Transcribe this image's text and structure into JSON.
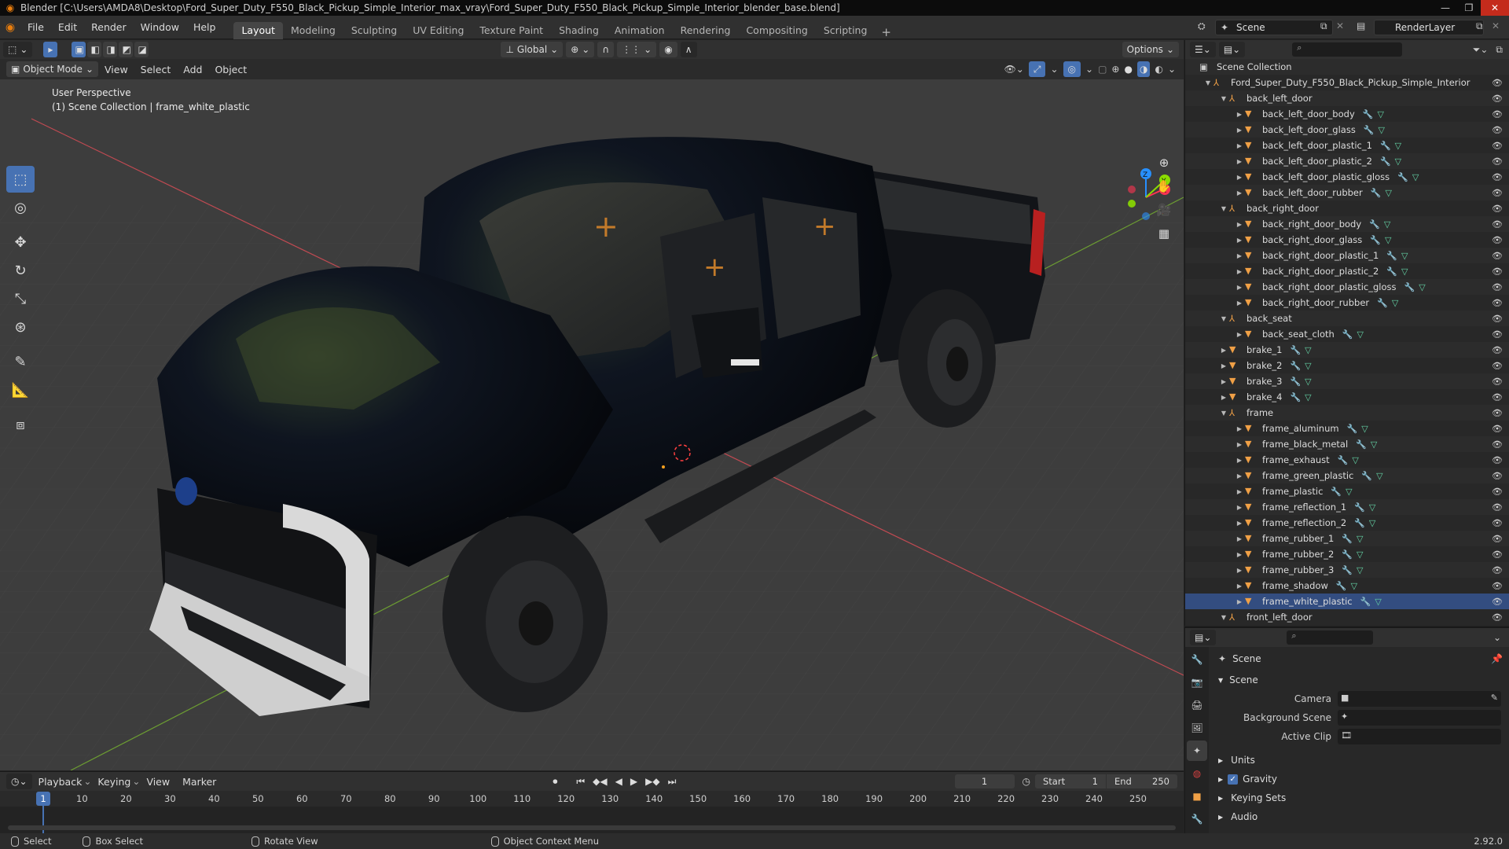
{
  "window": {
    "title": "Blender [C:\\Users\\AMDA8\\Desktop\\Ford_Super_Duty_F550_Black_Pickup_Simple_Interior_max_vray\\Ford_Super_Duty_F550_Black_Pickup_Simple_Interior_blender_base.blend]"
  },
  "menu": [
    "File",
    "Edit",
    "Render",
    "Window",
    "Help"
  ],
  "workspaces": [
    "Layout",
    "Modeling",
    "Sculpting",
    "UV Editing",
    "Texture Paint",
    "Shading",
    "Animation",
    "Rendering",
    "Compositing",
    "Scripting"
  ],
  "active_workspace": "Layout",
  "scene_name": "Scene",
  "render_layer": "RenderLayer",
  "viewport": {
    "mode": "Object Mode",
    "menus": [
      "View",
      "Select",
      "Add",
      "Object"
    ],
    "transform_orientation": "Global",
    "options_label": "Options",
    "overlay_line1": "User Perspective",
    "overlay_line2": "(1) Scene Collection | frame_white_plastic"
  },
  "gizmo": {
    "x": "X",
    "y": "Y",
    "z": "Z"
  },
  "outliner": {
    "root": "Scene Collection",
    "rows": [
      {
        "label": "Ford_Super_Duty_F550_Black_Pickup_Simple_Interior",
        "level": 0,
        "kind": "empty",
        "expanded": true
      },
      {
        "label": "back_left_door",
        "level": 1,
        "kind": "empty",
        "expanded": true
      },
      {
        "label": "back_left_door_body",
        "level": 2,
        "kind": "mesh"
      },
      {
        "label": "back_left_door_glass",
        "level": 2,
        "kind": "mesh"
      },
      {
        "label": "back_left_door_plastic_1",
        "level": 2,
        "kind": "mesh"
      },
      {
        "label": "back_left_door_plastic_2",
        "level": 2,
        "kind": "mesh"
      },
      {
        "label": "back_left_door_plastic_gloss",
        "level": 2,
        "kind": "mesh"
      },
      {
        "label": "back_left_door_rubber",
        "level": 2,
        "kind": "mesh"
      },
      {
        "label": "back_right_door",
        "level": 1,
        "kind": "empty",
        "expanded": true
      },
      {
        "label": "back_right_door_body",
        "level": 2,
        "kind": "mesh"
      },
      {
        "label": "back_right_door_glass",
        "level": 2,
        "kind": "mesh"
      },
      {
        "label": "back_right_door_plastic_1",
        "level": 2,
        "kind": "mesh"
      },
      {
        "label": "back_right_door_plastic_2",
        "level": 2,
        "kind": "mesh"
      },
      {
        "label": "back_right_door_plastic_gloss",
        "level": 2,
        "kind": "mesh"
      },
      {
        "label": "back_right_door_rubber",
        "level": 2,
        "kind": "mesh"
      },
      {
        "label": "back_seat",
        "level": 1,
        "kind": "empty",
        "expanded": true
      },
      {
        "label": "back_seat_cloth",
        "level": 2,
        "kind": "mesh"
      },
      {
        "label": "brake_1",
        "level": 1,
        "kind": "mesh"
      },
      {
        "label": "brake_2",
        "level": 1,
        "kind": "mesh"
      },
      {
        "label": "brake_3",
        "level": 1,
        "kind": "mesh"
      },
      {
        "label": "brake_4",
        "level": 1,
        "kind": "mesh"
      },
      {
        "label": "frame",
        "level": 1,
        "kind": "empty",
        "expanded": true
      },
      {
        "label": "frame_aluminum",
        "level": 2,
        "kind": "mesh"
      },
      {
        "label": "frame_black_metal",
        "level": 2,
        "kind": "mesh"
      },
      {
        "label": "frame_exhaust",
        "level": 2,
        "kind": "mesh"
      },
      {
        "label": "frame_green_plastic",
        "level": 2,
        "kind": "mesh"
      },
      {
        "label": "frame_plastic",
        "level": 2,
        "kind": "mesh"
      },
      {
        "label": "frame_reflection_1",
        "level": 2,
        "kind": "mesh"
      },
      {
        "label": "frame_reflection_2",
        "level": 2,
        "kind": "mesh"
      },
      {
        "label": "frame_rubber_1",
        "level": 2,
        "kind": "mesh"
      },
      {
        "label": "frame_rubber_2",
        "level": 2,
        "kind": "mesh"
      },
      {
        "label": "frame_rubber_3",
        "level": 2,
        "kind": "mesh"
      },
      {
        "label": "frame_shadow",
        "level": 2,
        "kind": "mesh"
      },
      {
        "label": "frame_white_plastic",
        "level": 2,
        "kind": "mesh",
        "active": true
      },
      {
        "label": "front_left_door",
        "level": 1,
        "kind": "empty",
        "expanded": true
      }
    ]
  },
  "properties": {
    "context": "Scene",
    "panel": "Scene",
    "fields": [
      {
        "label": "Camera",
        "value": ""
      },
      {
        "label": "Background Scene",
        "value": ""
      },
      {
        "label": "Active Clip",
        "value": ""
      }
    ],
    "subpanels": [
      {
        "label": "Units",
        "checkbox": false
      },
      {
        "label": "Gravity",
        "checkbox": true,
        "checked": true
      },
      {
        "label": "Keying Sets",
        "checkbox": false
      },
      {
        "label": "Audio",
        "checkbox": false
      }
    ],
    "version": "2.92.0"
  },
  "timeline": {
    "menus": [
      "Playback",
      "Keying",
      "View",
      "Marker"
    ],
    "current_frame": "1",
    "start_label": "Start",
    "start": "1",
    "end_label": "End",
    "end": "250",
    "ticks": [
      "1",
      "10",
      "20",
      "30",
      "40",
      "50",
      "60",
      "70",
      "80",
      "90",
      "100",
      "110",
      "120",
      "130",
      "140",
      "150",
      "160",
      "170",
      "180",
      "190",
      "200",
      "210",
      "220",
      "230",
      "240",
      "250"
    ]
  },
  "statusbar": {
    "select": "Select",
    "box_select": "Box Select",
    "rotate_view": "Rotate View",
    "context_menu": "Object Context Menu"
  },
  "colors": {
    "accent": "#4772b3",
    "blender_orange": "#e87d0d",
    "axis_x": "#ff3352",
    "axis_y": "#8bdc00",
    "axis_z": "#2890ff",
    "mesh_icon": "#f0a046",
    "modifier": "#7aa2e0",
    "mesh_data": "#64d2a5"
  }
}
